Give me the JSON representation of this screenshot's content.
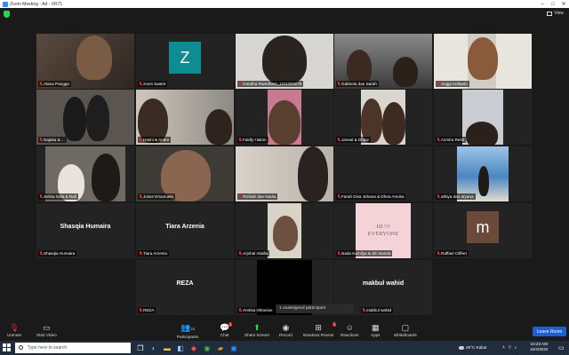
{
  "window": {
    "title": "Zoom Meeting - Ad - VR71"
  },
  "view_label": "View",
  "colors": {
    "accent": "#2d8cff",
    "active_speaker": "#c4e33a",
    "muted": "#e02828",
    "leave": "#1d5fd1"
  },
  "participants": [
    {
      "name": "Alana Pangga"
    },
    {
      "name": "zoom baa04",
      "initial": "Z",
      "avatar_color": "#0e8c8f"
    },
    {
      "name": "Gandha Ramdhani_1211003178"
    },
    {
      "name": "Gabriela dan Sarah"
    },
    {
      "name": "Anggi Ardianto"
    },
    {
      "name": "Najaka & ..."
    },
    {
      "name": "Hasni & Andre"
    },
    {
      "name": "Faldly Hakim"
    },
    {
      "name": "Jarwal & Dhaw"
    },
    {
      "name": "Azmira Resti"
    },
    {
      "name": "Selvia Sofa & Rafi"
    },
    {
      "name": "Josse Emanuela"
    },
    {
      "name": "Rizkiah dan Nadia"
    },
    {
      "name": "Farah Diva Johana & Dhea Annisa"
    },
    {
      "name": "athiya dan aryana"
    },
    {
      "name": "Shasqia Humaira",
      "display": "Shasqia Humaira"
    },
    {
      "name": "Tiara Arzenia",
      "display": "Tiara Arzenia"
    },
    {
      "name": "Arjohal Attalla"
    },
    {
      "name": "Nada Kamilya & Siti Nanda",
      "poster": "HI !!!\nEVERYONE"
    },
    {
      "name": "Raffael Cliffert",
      "initial": "m",
      "avatar_color": "#6b4a3a"
    },
    {
      "name": "REZA",
      "display": "REZA"
    },
    {
      "name": "Annisa Oktavian"
    },
    {
      "name": "makbul wahid",
      "display": "makbul wahid"
    }
  ],
  "unassigned": "1 unassigned participant",
  "toolbar": {
    "unmute": "Unmute",
    "start_video": "Start Video",
    "participants": "Participants",
    "participants_count": "23",
    "chat": "Chat",
    "chat_badge": "1",
    "share": "Share Screen",
    "record": "Record",
    "breakout": "Breakout Rooms",
    "breakout_badge": "1",
    "reactions": "Reactions",
    "apps": "Apps",
    "whiteboards": "Whiteboards",
    "leave": "Leave Room"
  },
  "taskbar": {
    "search_placeholder": "Type here to search",
    "weather": "29°C  Kabut",
    "time": "10:23 AM",
    "date": "10/4/2022"
  }
}
